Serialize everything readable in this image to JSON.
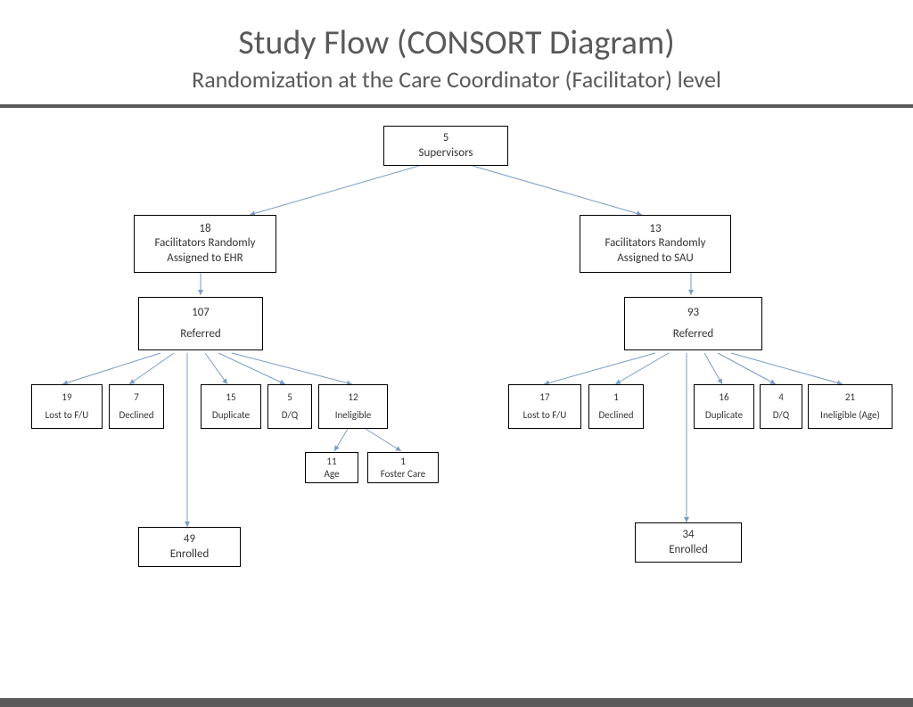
{
  "title": "Study Flow (CONSORT Diagram)",
  "subtitle": "Randomization at the Care Coordinator (Facilitator) level",
  "root": {
    "n": "5",
    "label": "Supervisors"
  },
  "left": {
    "arm": {
      "n": "18",
      "label": "Facilitators Randomly\nAssigned to EHR"
    },
    "referred": {
      "n": "107",
      "label": "Referred"
    },
    "outcomes": [
      {
        "n": "19",
        "label": "Lost to F/U"
      },
      {
        "n": "7",
        "label": "Declined"
      },
      {
        "n": "15",
        "label": "Duplicate"
      },
      {
        "n": "5",
        "label": "D/Q"
      },
      {
        "n": "12",
        "label": "Ineligible"
      }
    ],
    "ineligible_sub": [
      {
        "n": "11",
        "label": "Age"
      },
      {
        "n": "1",
        "label": "Foster Care"
      }
    ],
    "enrolled": {
      "n": "49",
      "label": "Enrolled"
    }
  },
  "right": {
    "arm": {
      "n": "13",
      "label": "Facilitators Randomly\nAssigned to SAU"
    },
    "referred": {
      "n": "93",
      "label": "Referred"
    },
    "outcomes": [
      {
        "n": "17",
        "label": "Lost to F/U"
      },
      {
        "n": "1",
        "label": "Declined"
      },
      {
        "n": "16",
        "label": "Duplicate"
      },
      {
        "n": "4",
        "label": "D/Q"
      },
      {
        "n": "21",
        "label": "Ineligible (Age)"
      }
    ],
    "enrolled": {
      "n": "34",
      "label": "Enrolled"
    }
  }
}
